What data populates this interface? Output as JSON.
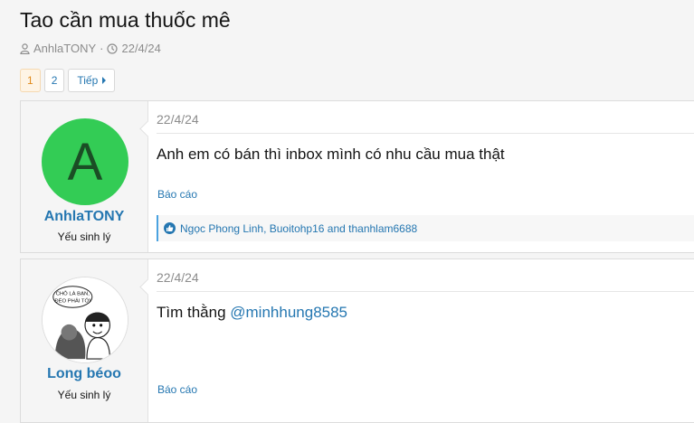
{
  "thread": {
    "title": "Tao cần mua thuốc mê",
    "author": "AnhlaTONY",
    "separator": "·",
    "date": "22/4/24"
  },
  "pagination": {
    "pages": [
      "1",
      "2"
    ],
    "current": "1",
    "next_label": "Tiếp"
  },
  "posts": [
    {
      "avatar_letter": "A",
      "username": "AnhlaTONY",
      "user_title": "Yếu sinh lý",
      "date": "22/4/24",
      "message": "Anh em có bán thì inbox mình có nhu cầu mua thật",
      "report_label": "Báo cáo",
      "reactions": "Ngọc Phong Linh, Buoitohp16 and thanhlam6688"
    },
    {
      "avatar_caption": "CHỖ LÀ BẠN, ĐÉO PHẢI TỚI",
      "username": "Long béoo",
      "user_title": "Yếu sinh lý",
      "date": "22/4/24",
      "message_prefix": "Tìm thằng ",
      "mention": "@minhhung8585",
      "report_label": "Báo cáo"
    }
  ],
  "colors": {
    "link": "#2577b1",
    "avatar_bg": "#33cc55",
    "current_page_bg": "#fef4e5",
    "current_page_text": "#e08a1c"
  }
}
